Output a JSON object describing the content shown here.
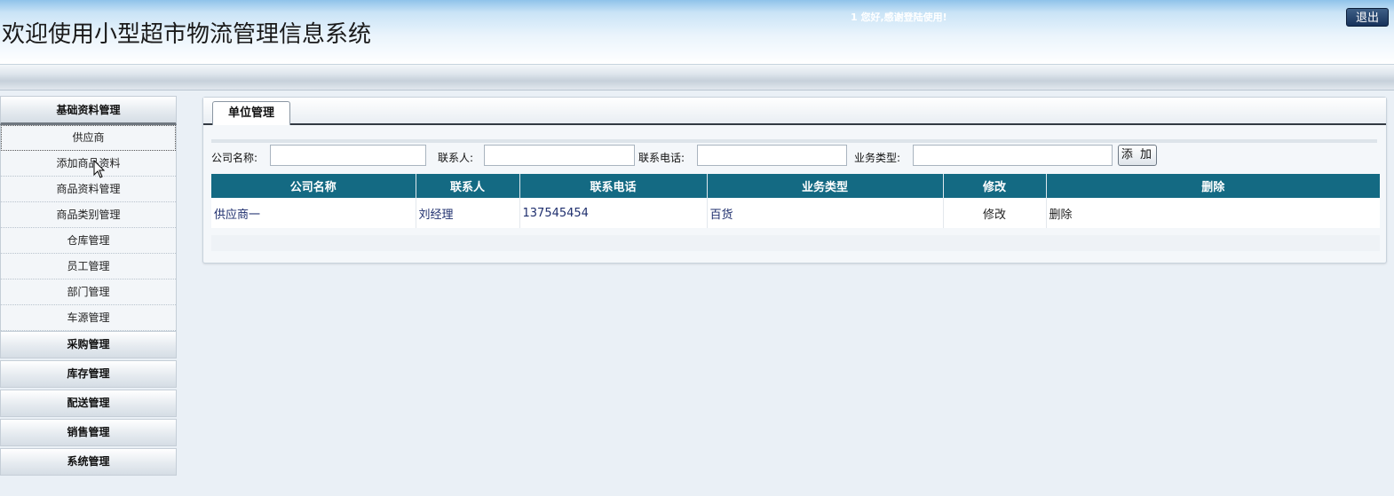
{
  "header": {
    "title": "欢迎使用小型超市物流管理信息系统",
    "welcome": "1 您好,感谢登陆使用!",
    "logout_label": "退出"
  },
  "sidebar": {
    "groups": [
      {
        "label": "基础资料管理",
        "items": [
          "供应商",
          "添加商品资料",
          "商品资料管理",
          "商品类别管理",
          "仓库管理",
          "员工管理",
          "部门管理",
          "车源管理"
        ]
      },
      {
        "label": "采购管理"
      },
      {
        "label": "库存管理"
      },
      {
        "label": "配送管理"
      },
      {
        "label": "销售管理"
      },
      {
        "label": "系统管理"
      }
    ]
  },
  "main": {
    "tab_label": "单位管理",
    "form": {
      "company_label": "公司名称:",
      "company_value": "",
      "contact_label": "联系人:",
      "contact_value": "",
      "phone_label": "联系电话:",
      "phone_value": "",
      "type_label": "业务类型:",
      "type_value": "",
      "add_label": "添 加"
    },
    "table": {
      "headers": [
        "公司名称",
        "联系人",
        "联系电话",
        "业务类型",
        "修改",
        "删除"
      ],
      "rows": [
        [
          "供应商一",
          "刘经理",
          "137545454",
          "百货",
          "修改",
          "删除"
        ]
      ]
    }
  },
  "colors": {
    "table_header": "#146a83",
    "link_text": "#1f2f6e",
    "logout_bg": "#16325a"
  }
}
